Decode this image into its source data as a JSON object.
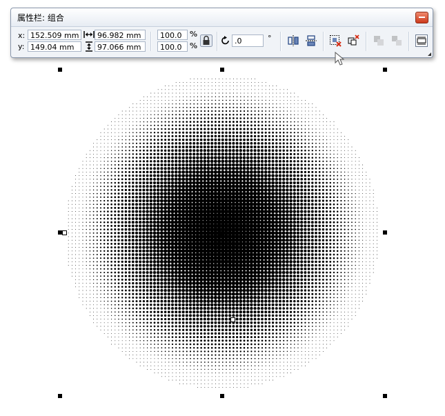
{
  "window": {
    "title": "属性栏: 组合"
  },
  "toolbar": {
    "x_label": "x:",
    "x_value": "152.509 mm",
    "y_label": "y:",
    "y_value": "149.04 mm",
    "width_value": "96.982 mm",
    "height_value": "97.066 mm",
    "scale_x_value": "100.0",
    "scale_y_value": "100.0",
    "percent_symbol": "%",
    "rotation_value": ".0",
    "degree_symbol": "°"
  },
  "icons": [
    "width-arrows-icon",
    "height-arrows-icon",
    "lock-ratio-icon",
    "rotate-icon",
    "mirror-horizontal-icon",
    "mirror-vertical-icon",
    "group-icon",
    "ungroup-icon",
    "combine-icon",
    "break-apart-icon",
    "wrap-text-icon"
  ],
  "colors": {
    "bar_background": "#f0f3f7",
    "close_button": "#cc3a1c",
    "halftone": "#000000"
  }
}
